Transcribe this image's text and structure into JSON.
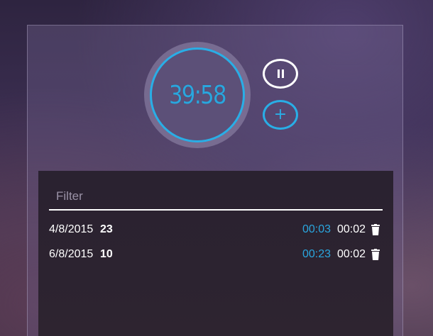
{
  "timer": {
    "display": "39:58"
  },
  "controls": {
    "pause_icon": "pause-icon",
    "add_icon": "plus-icon",
    "add_symbol": "+"
  },
  "filter": {
    "placeholder": "Filter",
    "value": ""
  },
  "entries": [
    {
      "date": "4/8/2015",
      "count": "23",
      "time_a": "00:03",
      "time_b": "00:02",
      "icon": "trash-icon"
    },
    {
      "date": "6/8/2015",
      "count": "10",
      "time_a": "00:23",
      "time_b": "00:02",
      "icon": "trash-icon"
    }
  ],
  "colors": {
    "accent": "#29aee6",
    "white": "#ffffff"
  }
}
